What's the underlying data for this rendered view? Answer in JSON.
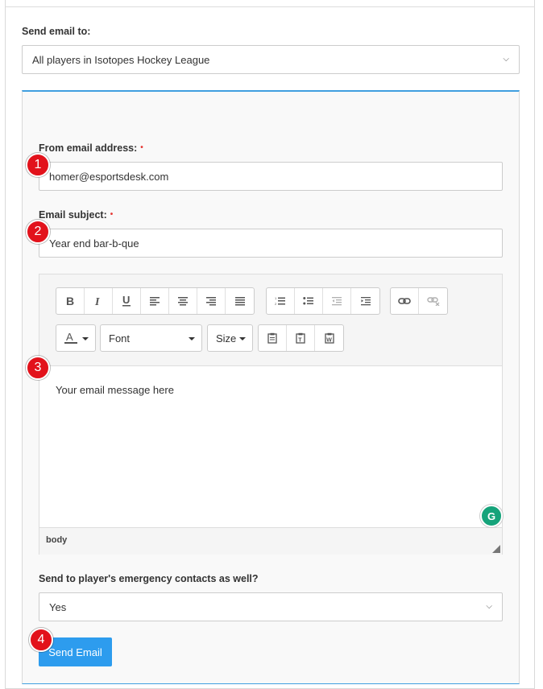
{
  "send_to": {
    "label": "Send email to:",
    "value": "All players in Isotopes Hockey League"
  },
  "from": {
    "label": "From email address:",
    "required": "•",
    "value": "homer@esportsdesk.com"
  },
  "subject": {
    "label": "Email subject:",
    "required": "•",
    "value": "Year end bar-b-que"
  },
  "editor": {
    "font_label": "Font",
    "size_label": "Size",
    "body_text": "Your email message here",
    "status_path": "body",
    "grammarly_letter": "G"
  },
  "emergency": {
    "label": "Send to player's emergency contacts as well?",
    "value": "Yes"
  },
  "send_button": "Send Email",
  "markers": [
    "1",
    "2",
    "3",
    "4"
  ],
  "colors": {
    "accent": "#2d9cee",
    "panel_border": "#3f9fe0",
    "marker": "#e2121b",
    "required": "#e53935",
    "grammarly": "#15a37a"
  }
}
